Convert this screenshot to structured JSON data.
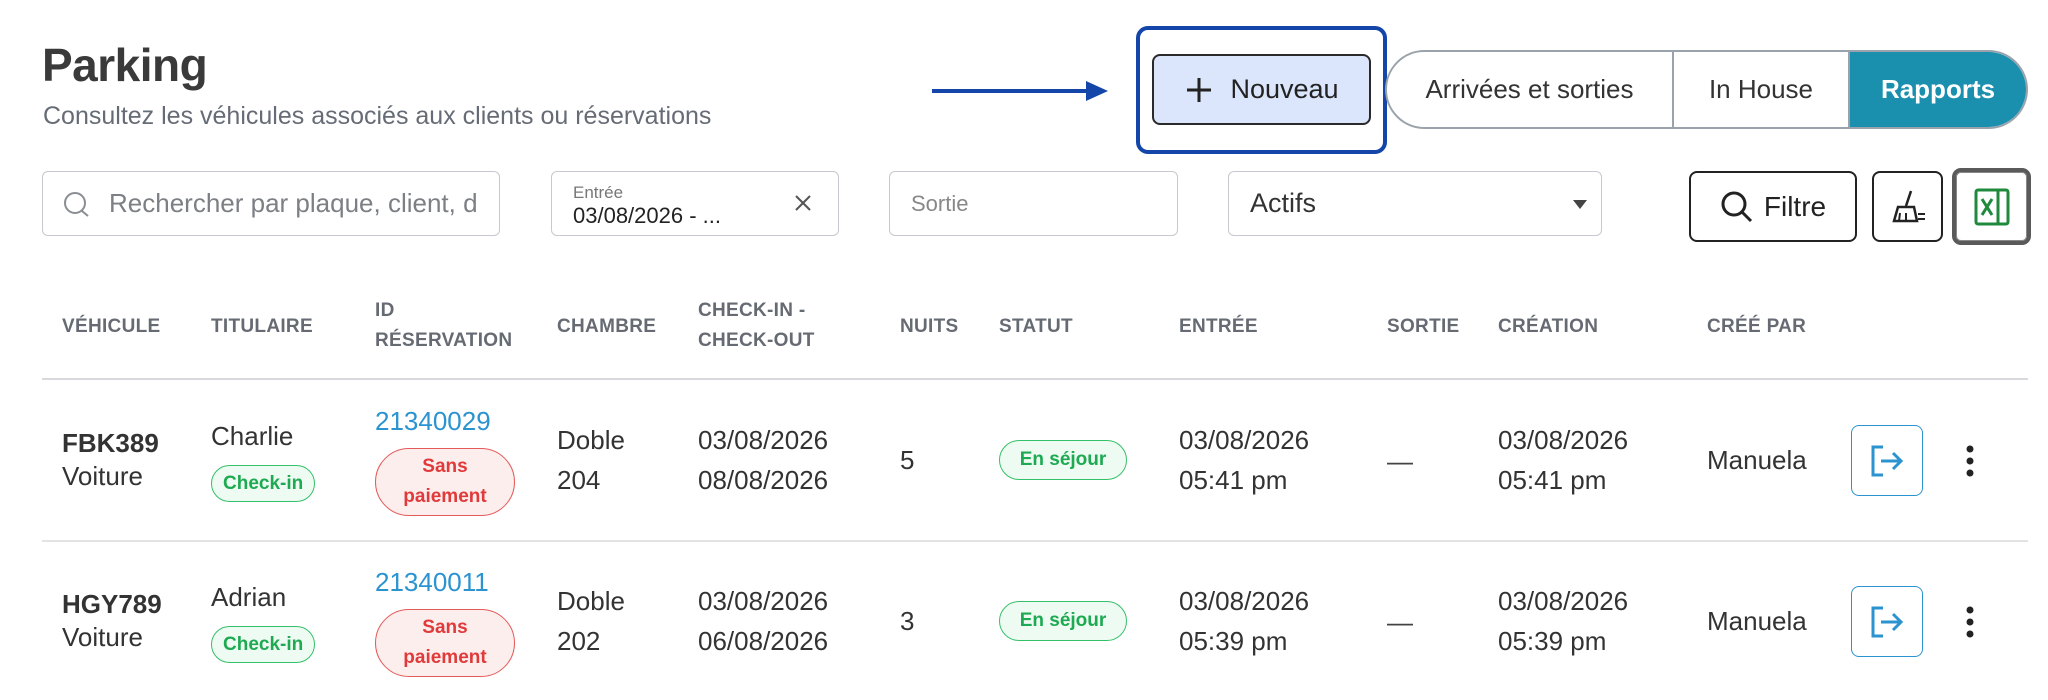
{
  "header": {
    "title": "Parking",
    "subtitle": "Consultez les véhicules associés aux clients ou réservations",
    "new_label": "Nouveau"
  },
  "tabs": [
    {
      "label": "Arrivées et sorties",
      "active": false
    },
    {
      "label": "In House",
      "active": false
    },
    {
      "label": "Rapports",
      "active": true
    }
  ],
  "filters": {
    "search_placeholder": "Rechercher par plaque, client, d",
    "entry_label": "Entrée",
    "entry_value": "03/08/2026 - ...",
    "exit_placeholder": "Sortie",
    "status_value": "Actifs",
    "filter_label": "Filtre"
  },
  "table": {
    "headers": {
      "vehicle": "VÉHICULE",
      "holder": "TITULAIRE",
      "res_1": "ID",
      "res_2": "RÉSERVATION",
      "room": "CHAMBRE",
      "checkin_1": "CHECK-IN -",
      "checkin_2": "CHECK-OUT",
      "nights": "NUITS",
      "status": "STATUT",
      "entry": "ENTRÉE",
      "exit": "SORTIE",
      "created": "CRÉATION",
      "created_by": "CRÉÉ PAR"
    },
    "rows": [
      {
        "plate": "FBK389",
        "vehicle_type": "Voiture",
        "holder": "Charlie",
        "holder_badge": "Check-in",
        "reservation_id": "21340029",
        "payment_1": "Sans",
        "payment_2": "paiement",
        "room_type": "Doble",
        "room_number": "204",
        "check_in": "03/08/2026",
        "check_out": "08/08/2026",
        "nights": "5",
        "status": "En séjour",
        "entry_date": "03/08/2026",
        "entry_time": "05:41 pm",
        "exit": "—",
        "created_date": "03/08/2026",
        "created_time": "05:41 pm",
        "created_by": "Manuela"
      },
      {
        "plate": "HGY789",
        "vehicle_type": "Voiture",
        "holder": "Adrian",
        "holder_badge": "Check-in",
        "reservation_id": "21340011",
        "payment_1": "Sans",
        "payment_2": "paiement",
        "room_type": "Doble",
        "room_number": "202",
        "check_in": "03/08/2026",
        "check_out": "06/08/2026",
        "nights": "3",
        "status": "En séjour",
        "entry_date": "03/08/2026",
        "entry_time": "05:39 pm",
        "exit": "—",
        "created_date": "03/08/2026",
        "created_time": "05:39 pm",
        "created_by": "Manuela"
      }
    ]
  },
  "colors": {
    "accent": "#1a8fae",
    "link": "#2b93cf",
    "success": "#1eaa52",
    "danger": "#e03a3a",
    "highlight": "#1346a8"
  },
  "icons": [
    "search-icon",
    "plus-icon",
    "close-icon",
    "chevron-down-icon",
    "magnifier-icon",
    "broom-icon",
    "excel-icon",
    "logout-icon",
    "more-vertical-icon"
  ]
}
